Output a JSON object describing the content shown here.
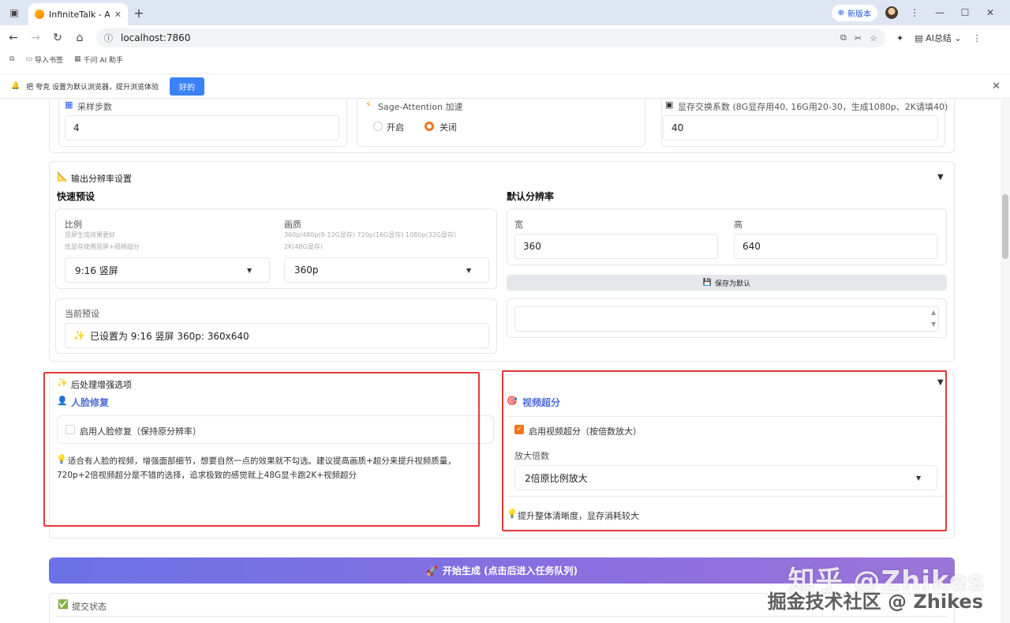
{
  "browser": {
    "tab_title": "InfiniteTalk - AI数",
    "new_version": "新版本",
    "url": "localhost:7860",
    "ai_summary": "AI总结",
    "bookmarks": [
      "导入书签",
      "千问 AI 助手"
    ],
    "notify_text": "把 夸克 设置为默认浏览器，提升浏览体验",
    "notify_ok": "好的"
  },
  "top_row": {
    "steps_label": "采样步数",
    "steps_value": "4",
    "sage_label": "Sage-Attention 加速",
    "sage_on": "开启",
    "sage_off": "关闭",
    "swap_label": "显存交换系数 (8G显存用40, 16G用20-30，生成1080p、2K请填40)",
    "swap_value": "40"
  },
  "resolution": {
    "section_title": "输出分辨率设置",
    "quick_preset": "快速预设",
    "default_res": "默认分辨率",
    "ratio_label": "比例",
    "ratio_hint1": "竖屏生成效果更好",
    "ratio_hint2": "低显存使用竖屏+视频超分",
    "ratio_value": "9:16 竖屏",
    "quality_label": "画质",
    "quality_hint1": "360p/480p(8-12G显存) 720p(16G显存) 1080p(32G显存)",
    "quality_hint2": "2K(48G显存)",
    "quality_value": "360p",
    "width_label": "宽",
    "width_value": "360",
    "height_label": "高",
    "height_value": "640",
    "save_default": "保存为默认",
    "current_preset_label": "当前预设",
    "current_preset_value": "已设置为 9:16 竖屏 360p: 360x640"
  },
  "postprocess": {
    "section_title": "后处理增强选项",
    "face_title": "人脸修复",
    "face_checkbox": "启用人脸修复（保持原分辨率）",
    "face_tip_line1": "适合有人脸的视频，增强面部细节，想要自然一点的效果就不勾选。建议提高画质+超分来提升视频质量，",
    "face_tip_line2": "720p+2倍视频超分是不错的选择，追求极致的感觉就上48G显卡跑2K+视频超分",
    "sr_title": "视频超分",
    "sr_checkbox": "启用视频超分（按倍数放大）",
    "scale_label": "放大倍数",
    "scale_value": "2倍原比例放大",
    "sr_tip": "提升整体清晰度，显存消耗较大"
  },
  "actions": {
    "generate": "开始生成 (点击后进入任务队列)",
    "submit_status": "提交状态"
  },
  "watermark": {
    "line1": "知乎 @Zhikes",
    "line2": "掘金技术社区 @ Zhikes"
  },
  "colors": {
    "accent": "#f97316",
    "primary_button": "#6a72e6",
    "highlight_box": "#e53935",
    "section_title": "#4f6bd8"
  }
}
